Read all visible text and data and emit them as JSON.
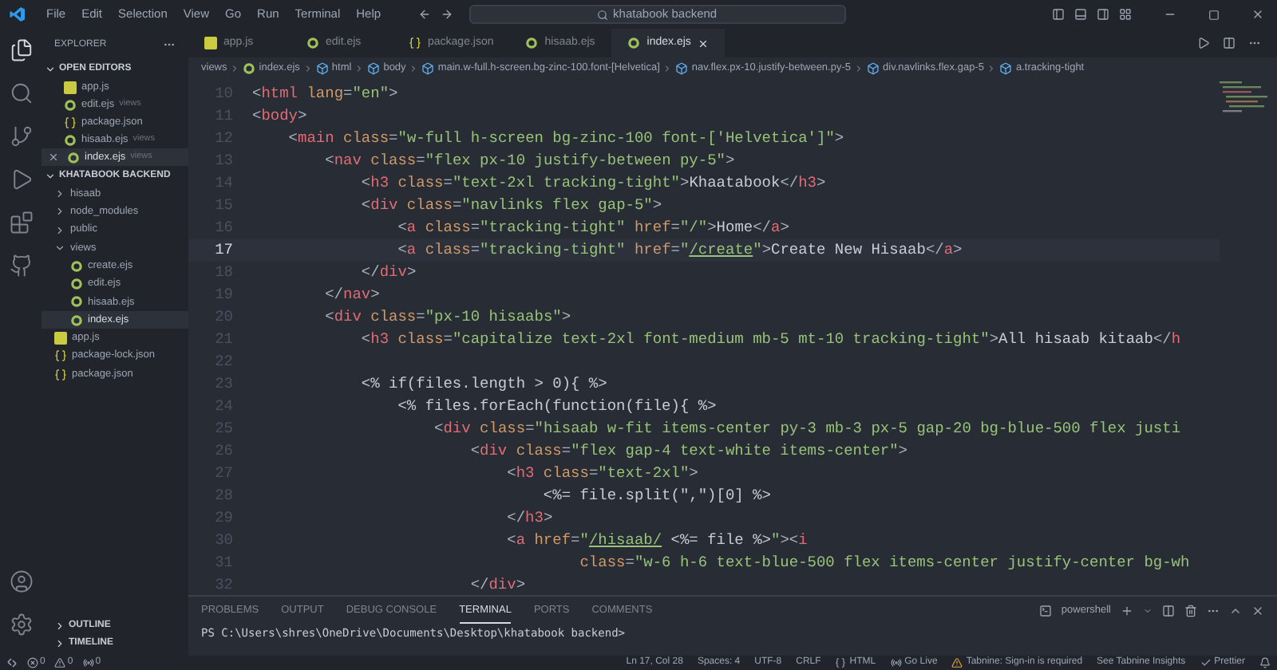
{
  "menu": [
    "File",
    "Edit",
    "Selection",
    "View",
    "Go",
    "Run",
    "Terminal",
    "Help"
  ],
  "search": {
    "value": "khatabook backend"
  },
  "explorer": {
    "title": "EXPLORER",
    "open_editors": {
      "title": "OPEN EDITORS",
      "expanded": true,
      "items": [
        {
          "name": "app.js",
          "kind": "js",
          "selected": false
        },
        {
          "name": "edit.ejs",
          "folder": "views",
          "kind": "ejs",
          "selected": false
        },
        {
          "name": "package.json",
          "kind": "json",
          "selected": false
        },
        {
          "name": "hisaab.ejs",
          "folder": "views",
          "kind": "ejs",
          "selected": false
        },
        {
          "name": "index.ejs",
          "folder": "views",
          "kind": "ejs",
          "selected": true
        }
      ]
    },
    "project": {
      "title": "KHATABOOK BACKEND",
      "expanded": true,
      "items": [
        {
          "name": "hisaab",
          "kind": "folder",
          "expanded": false,
          "selected": false
        },
        {
          "name": "node_modules",
          "kind": "folder",
          "expanded": false,
          "selected": false
        },
        {
          "name": "public",
          "kind": "folder",
          "expanded": false,
          "selected": false
        },
        {
          "name": "views",
          "kind": "folder",
          "expanded": true,
          "selected": false,
          "children": [
            {
              "name": "create.ejs",
              "kind": "ejs",
              "selected": false
            },
            {
              "name": "edit.ejs",
              "kind": "ejs",
              "selected": false
            },
            {
              "name": "hisaab.ejs",
              "kind": "ejs",
              "selected": false
            },
            {
              "name": "index.ejs",
              "kind": "ejs",
              "selected": true
            }
          ]
        },
        {
          "name": "app.js",
          "kind": "js",
          "selected": false
        },
        {
          "name": "package-lock.json",
          "kind": "json",
          "selected": false
        },
        {
          "name": "package.json",
          "kind": "json",
          "selected": false
        }
      ]
    },
    "bottom_sections": [
      "OUTLINE",
      "TIMELINE"
    ]
  },
  "tabs": [
    {
      "name": "app.js",
      "kind": "js",
      "selected": false
    },
    {
      "name": "edit.ejs",
      "kind": "ejs",
      "selected": false
    },
    {
      "name": "package.json",
      "kind": "json",
      "selected": false
    },
    {
      "name": "hisaab.ejs",
      "kind": "ejs",
      "selected": false
    },
    {
      "name": "index.ejs",
      "kind": "ejs",
      "selected": true
    }
  ],
  "breadcrumbs": [
    {
      "text": "views",
      "kind": "folder"
    },
    {
      "text": "index.ejs",
      "kind": "ejs"
    },
    {
      "text": "html",
      "kind": "element"
    },
    {
      "text": "body",
      "kind": "element"
    },
    {
      "text": "main.w-full.h-screen.bg-zinc-100.font-[Helvetica]",
      "kind": "element"
    },
    {
      "text": "nav.flex.px-10.justify-between.py-5",
      "kind": "element"
    },
    {
      "text": "div.navlinks.flex.gap-5",
      "kind": "element"
    },
    {
      "text": "a.tracking-tight",
      "kind": "element"
    }
  ],
  "code": [
    {
      "number": "10",
      "current": false,
      "tokens": [
        {
          "kind": "punct",
          "text": "<"
        },
        {
          "kind": "tag",
          "text": "html"
        },
        {
          "kind": "attr",
          "text": " lang"
        },
        {
          "kind": "punct",
          "text": "="
        },
        {
          "kind": "string",
          "text": "\"en\""
        },
        {
          "kind": "punct",
          "text": ">"
        }
      ]
    },
    {
      "number": "11",
      "current": false,
      "tokens": [
        {
          "kind": "punct",
          "text": "<"
        },
        {
          "kind": "tag",
          "text": "body"
        },
        {
          "kind": "punct",
          "text": ">"
        }
      ]
    },
    {
      "number": "12",
      "current": false,
      "tokens": [
        {
          "kind": "punct",
          "text": "    <"
        },
        {
          "kind": "tag",
          "text": "main"
        },
        {
          "kind": "attr",
          "text": " class"
        },
        {
          "kind": "punct",
          "text": "="
        },
        {
          "kind": "string",
          "text": "\"w-full h-screen bg-zinc-100 font-['Helvetica']\""
        },
        {
          "kind": "punct",
          "text": ">"
        }
      ]
    },
    {
      "number": "13",
      "current": false,
      "tokens": [
        {
          "kind": "punct",
          "text": "        <"
        },
        {
          "kind": "tag",
          "text": "nav"
        },
        {
          "kind": "attr",
          "text": " class"
        },
        {
          "kind": "punct",
          "text": "="
        },
        {
          "kind": "string",
          "text": "\"flex px-10 justify-between py-5\""
        },
        {
          "kind": "punct",
          "text": ">"
        }
      ]
    },
    {
      "number": "14",
      "current": false,
      "tokens": [
        {
          "kind": "punct",
          "text": "            <"
        },
        {
          "kind": "tag",
          "text": "h3"
        },
        {
          "kind": "attr",
          "text": " class"
        },
        {
          "kind": "punct",
          "text": "="
        },
        {
          "kind": "string",
          "text": "\"text-2xl tracking-tight\""
        },
        {
          "kind": "punct",
          "text": ">"
        },
        {
          "kind": "text",
          "text": "Khaatabook"
        },
        {
          "kind": "punct",
          "text": "</"
        },
        {
          "kind": "tag",
          "text": "h3"
        },
        {
          "kind": "punct",
          "text": ">"
        }
      ]
    },
    {
      "number": "15",
      "current": false,
      "tokens": [
        {
          "kind": "punct",
          "text": "            <"
        },
        {
          "kind": "tag",
          "text": "div"
        },
        {
          "kind": "attr",
          "text": " class"
        },
        {
          "kind": "punct",
          "text": "="
        },
        {
          "kind": "string",
          "text": "\"navlinks flex gap-5\""
        },
        {
          "kind": "punct",
          "text": ">"
        }
      ]
    },
    {
      "number": "16",
      "current": false,
      "tokens": [
        {
          "kind": "punct",
          "text": "                <"
        },
        {
          "kind": "tag",
          "text": "a"
        },
        {
          "kind": "attr",
          "text": " class"
        },
        {
          "kind": "punct",
          "text": "="
        },
        {
          "kind": "string",
          "text": "\"tracking-tight\""
        },
        {
          "kind": "attr",
          "text": " href"
        },
        {
          "kind": "punct",
          "text": "="
        },
        {
          "kind": "string",
          "text": "\"/\""
        },
        {
          "kind": "punct",
          "text": ">"
        },
        {
          "kind": "text",
          "text": "Home"
        },
        {
          "kind": "punct",
          "text": "</"
        },
        {
          "kind": "tag",
          "text": "a"
        },
        {
          "kind": "punct",
          "text": ">"
        }
      ]
    },
    {
      "number": "17",
      "current": true,
      "tokens": [
        {
          "kind": "punct",
          "text": "                <"
        },
        {
          "kind": "tag",
          "text": "a"
        },
        {
          "kind": "attr",
          "text": " class"
        },
        {
          "kind": "punct",
          "text": "="
        },
        {
          "kind": "string",
          "text": "\"tracking-tight\""
        },
        {
          "kind": "attr",
          "text": " href"
        },
        {
          "kind": "punct",
          "text": "="
        },
        {
          "kind": "string",
          "text": "\""
        },
        {
          "kind": "link",
          "text": "/create"
        },
        {
          "kind": "string",
          "text": "\""
        },
        {
          "kind": "punct",
          "text": ">"
        },
        {
          "kind": "text",
          "text": "Create New Hisaab"
        },
        {
          "kind": "punct",
          "text": "</"
        },
        {
          "kind": "tag",
          "text": "a"
        },
        {
          "kind": "punct",
          "text": ">"
        }
      ]
    },
    {
      "number": "18",
      "current": false,
      "tokens": [
        {
          "kind": "punct",
          "text": "            </"
        },
        {
          "kind": "tag",
          "text": "div"
        },
        {
          "kind": "punct",
          "text": ">"
        }
      ]
    },
    {
      "number": "19",
      "current": false,
      "tokens": [
        {
          "kind": "punct",
          "text": "        </"
        },
        {
          "kind": "tag",
          "text": "nav"
        },
        {
          "kind": "punct",
          "text": ">"
        }
      ]
    },
    {
      "number": "20",
      "current": false,
      "tokens": [
        {
          "kind": "punct",
          "text": "        <"
        },
        {
          "kind": "tag",
          "text": "div"
        },
        {
          "kind": "attr",
          "text": " class"
        },
        {
          "kind": "punct",
          "text": "="
        },
        {
          "kind": "string",
          "text": "\"px-10 hisaabs\""
        },
        {
          "kind": "punct",
          "text": ">"
        }
      ]
    },
    {
      "number": "21",
      "current": false,
      "tokens": [
        {
          "kind": "punct",
          "text": "            <"
        },
        {
          "kind": "tag",
          "text": "h3"
        },
        {
          "kind": "attr",
          "text": " class"
        },
        {
          "kind": "punct",
          "text": "="
        },
        {
          "kind": "string",
          "text": "\"capitalize text-2xl font-medium mb-5 mt-10 tracking-tight\""
        },
        {
          "kind": "punct",
          "text": ">"
        },
        {
          "kind": "text",
          "text": "All hisaab kitaab"
        },
        {
          "kind": "punct",
          "text": "</"
        },
        {
          "kind": "tag",
          "text": "h"
        }
      ]
    },
    {
      "number": "22",
      "current": false
    },
    {
      "number": "23",
      "current": false,
      "tokens": [
        {
          "kind": "ejs",
          "text": "            <% if(files.length > 0){ %>"
        }
      ]
    },
    {
      "number": "24",
      "current": false,
      "tokens": [
        {
          "kind": "ejs",
          "text": "                <% files.forEach(function(file){ %>"
        }
      ]
    },
    {
      "number": "25",
      "current": false,
      "tokens": [
        {
          "kind": "punct",
          "text": "                    <"
        },
        {
          "kind": "tag",
          "text": "div"
        },
        {
          "kind": "attr",
          "text": " class"
        },
        {
          "kind": "punct",
          "text": "="
        },
        {
          "kind": "string",
          "text": "\"hisaab w-fit items-center py-3 mb-3 px-5 gap-20 bg-blue-500 flex justi"
        }
      ]
    },
    {
      "number": "26",
      "current": false,
      "tokens": [
        {
          "kind": "punct",
          "text": "                        <"
        },
        {
          "kind": "tag",
          "text": "div"
        },
        {
          "kind": "attr",
          "text": " class"
        },
        {
          "kind": "punct",
          "text": "="
        },
        {
          "kind": "string",
          "text": "\"flex gap-4 text-white items-center\""
        },
        {
          "kind": "punct",
          "text": ">"
        }
      ]
    },
    {
      "number": "27",
      "current": false,
      "tokens": [
        {
          "kind": "punct",
          "text": "                            <"
        },
        {
          "kind": "tag",
          "text": "h3"
        },
        {
          "kind": "attr",
          "text": " class"
        },
        {
          "kind": "punct",
          "text": "="
        },
        {
          "kind": "string",
          "text": "\"text-2xl\""
        },
        {
          "kind": "punct",
          "text": ">"
        }
      ]
    },
    {
      "number": "28",
      "current": false,
      "tokens": [
        {
          "kind": "ejs",
          "text": "                                <%= file.split(\",\")[0] %>"
        }
      ]
    },
    {
      "number": "29",
      "current": false,
      "tokens": [
        {
          "kind": "punct",
          "text": "                            </"
        },
        {
          "kind": "tag",
          "text": "h3"
        },
        {
          "kind": "punct",
          "text": ">"
        }
      ]
    },
    {
      "number": "30",
      "current": false,
      "tokens": [
        {
          "kind": "punct",
          "text": "                            <"
        },
        {
          "kind": "tag",
          "text": "a"
        },
        {
          "kind": "attr",
          "text": " href"
        },
        {
          "kind": "punct",
          "text": "="
        },
        {
          "kind": "string",
          "text": "\""
        },
        {
          "kind": "link",
          "text": "/hisaab/"
        },
        {
          "kind": "ejs",
          "text": " <%= file %>"
        },
        {
          "kind": "string",
          "text": "\""
        },
        {
          "kind": "punct",
          "text": "><"
        },
        {
          "kind": "tag",
          "text": "i"
        }
      ]
    },
    {
      "number": "31",
      "current": false,
      "tokens": [
        {
          "kind": "attr",
          "text": "                                    class"
        },
        {
          "kind": "punct",
          "text": "="
        },
        {
          "kind": "string",
          "text": "\"w-6 h-6 text-blue-500 flex items-center justify-center bg-wh"
        }
      ]
    },
    {
      "number": "32",
      "current": false,
      "tokens": [
        {
          "kind": "punct",
          "text": "                        </"
        },
        {
          "kind": "tag",
          "text": "div"
        },
        {
          "kind": "punct",
          "text": ">"
        }
      ]
    }
  ],
  "panel": {
    "tabs": [
      {
        "label": "PROBLEMS",
        "selected": false
      },
      {
        "label": "OUTPUT",
        "selected": false
      },
      {
        "label": "DEBUG CONSOLE",
        "selected": false
      },
      {
        "label": "TERMINAL",
        "selected": true
      },
      {
        "label": "PORTS",
        "selected": false
      },
      {
        "label": "COMMENTS",
        "selected": false
      }
    ],
    "shell": "powershell",
    "terminal": "PS C:\\Users\\shres\\OneDrive\\Documents\\Desktop\\khatabook backend>"
  },
  "status_bar": {
    "left": [
      {
        "kind": "errors",
        "text": "0"
      },
      {
        "kind": "warnings",
        "text": "0"
      },
      {
        "kind": "ports",
        "text": "0"
      }
    ],
    "right": [
      {
        "kind": "text",
        "text": "Ln 17, Col 28"
      },
      {
        "kind": "text",
        "text": "Spaces: 4"
      },
      {
        "kind": "text",
        "text": "UTF-8"
      },
      {
        "kind": "text",
        "text": "CRLF"
      },
      {
        "kind": "language",
        "text": "HTML"
      },
      {
        "kind": "live",
        "text": "Go Live"
      },
      {
        "kind": "warning",
        "text": "Tabnine: Sign-in is required"
      },
      {
        "kind": "text",
        "text": "See Tabnine Insights"
      },
      {
        "kind": "check",
        "text": "Prettier"
      }
    ]
  }
}
